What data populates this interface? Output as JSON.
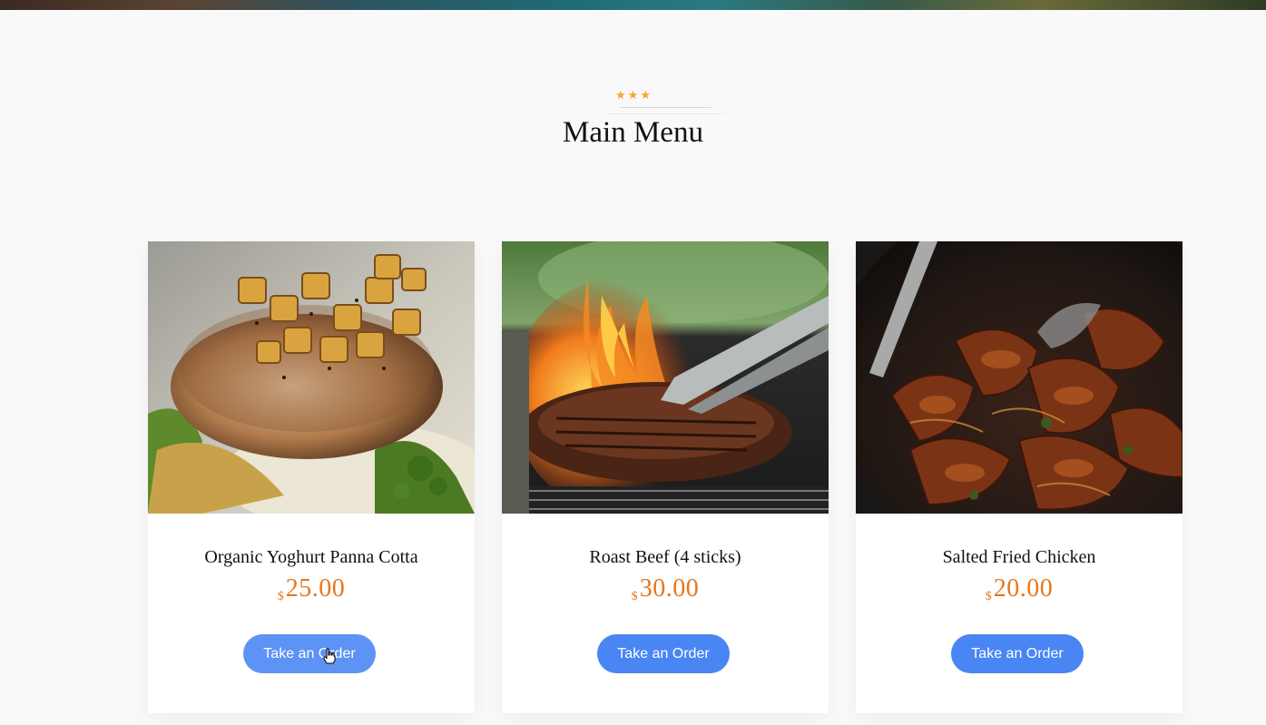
{
  "section": {
    "stars": "★★★",
    "title": "Main Menu"
  },
  "menu_items": [
    {
      "name": "Organic Yoghurt Panna Cotta",
      "currency": "$",
      "price": "25.00",
      "button_label": "Take an Order"
    },
    {
      "name": "Roast Beef (4 sticks)",
      "currency": "$",
      "price": "30.00",
      "button_label": "Take an Order"
    },
    {
      "name": "Salted Fried Chicken",
      "currency": "$",
      "price": "20.00",
      "button_label": "Take an Order"
    }
  ],
  "colors": {
    "accent_price": "#e8761c",
    "button": "#4a86f3",
    "stars": "#f5a623"
  }
}
